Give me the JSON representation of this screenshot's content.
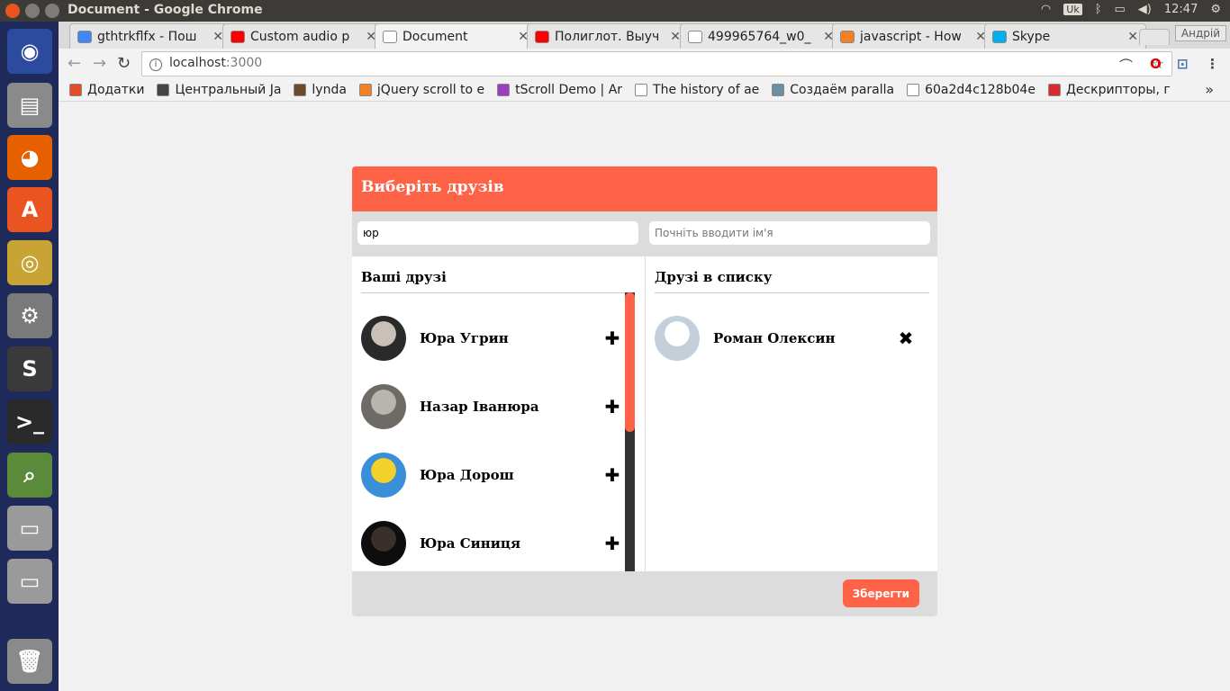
{
  "window": {
    "title": "Document - Google Chrome"
  },
  "tray": {
    "keyboard": "Uk",
    "time": "12:47"
  },
  "launcher": {
    "items": [
      {
        "name": "ubuntu-dash-icon",
        "color": "#2c4a9e"
      },
      {
        "name": "files-icon",
        "color": "#8a8a8a"
      },
      {
        "name": "firefox-icon",
        "color": "#e66000"
      },
      {
        "name": "software-center-icon",
        "color": "#e95420"
      },
      {
        "name": "chrome-icon",
        "color": "#c8a435"
      },
      {
        "name": "settings-icon",
        "color": "#7a7a7a"
      },
      {
        "name": "sublime-text-icon",
        "color": "#3a3a3a"
      },
      {
        "name": "terminal-icon",
        "color": "#2a2a2a"
      },
      {
        "name": "image-viewer-icon",
        "color": "#5a8a3a"
      },
      {
        "name": "drive-icon",
        "color": "#9a9a9a"
      },
      {
        "name": "drive-icon",
        "color": "#9a9a9a"
      },
      {
        "name": "trash-icon",
        "color": "#8a8a8a"
      }
    ]
  },
  "tabs": [
    {
      "label": "gthtrkflfx - Пош",
      "icon": "google-icon",
      "color": "#4285f4",
      "active": false
    },
    {
      "label": "Custom audio p",
      "icon": "youtube-icon",
      "color": "#ff0000",
      "active": false
    },
    {
      "label": "Document",
      "icon": "page-icon",
      "color": "#ffffff",
      "active": true
    },
    {
      "label": "Полиглот. Выуч",
      "icon": "youtube-icon",
      "color": "#ff0000",
      "active": false
    },
    {
      "label": "499965764_w0_",
      "icon": "page-icon",
      "color": "#ffffff",
      "active": false
    },
    {
      "label": "javascript - How",
      "icon": "stackoverflow-icon",
      "color": "#f48024",
      "active": false
    },
    {
      "label": "Skype",
      "icon": "skype-icon",
      "color": "#00aff0",
      "active": false
    }
  ],
  "profile": {
    "name": "Андрій"
  },
  "address": {
    "host": "localhost",
    "port": ":3000"
  },
  "bookmarks": {
    "items": [
      {
        "label": "Додатки",
        "icon": "apps-icon",
        "color": "#e14d2a"
      },
      {
        "label": "Центральный Ja",
        "icon": "bookmark-icon",
        "color": "#444444"
      },
      {
        "label": "lynda",
        "icon": "lynda-icon",
        "color": "#6b4a2e"
      },
      {
        "label": "jQuery scroll to e",
        "icon": "stackoverflow-icon",
        "color": "#f48024"
      },
      {
        "label": "tScroll Demo | Ar",
        "icon": "t-icon",
        "color": "#9b3fbf"
      },
      {
        "label": "The history of ae",
        "icon": "page-icon",
        "color": "#ffffff"
      },
      {
        "label": "Создаём paralla",
        "icon": "habr-icon",
        "color": "#6b8fa8"
      },
      {
        "label": "60a2d4c128b04e",
        "icon": "page-icon",
        "color": "#ffffff"
      },
      {
        "label": "Дескрипторы, г",
        "icon": "bookmark-icon",
        "color": "#d92b2b"
      }
    ],
    "more": "»"
  },
  "dialog": {
    "title": "Виберіть друзів",
    "search_left": {
      "value": "юр",
      "placeholder": ""
    },
    "search_right": {
      "value": "",
      "placeholder": "Почніть вводити ім'я"
    },
    "left_title": "Ваші друзі",
    "right_title": "Друзі в списку",
    "friends": [
      {
        "name": "Юра Угрин",
        "action": "✚",
        "avatar_colors": [
          "#2a2a2a",
          "#c9c1b8"
        ]
      },
      {
        "name": "Назар Іванюра",
        "action": "✚",
        "avatar_colors": [
          "#6e6a66",
          "#b8b4ae"
        ]
      },
      {
        "name": "Юра Дорош",
        "action": "✚",
        "avatar_colors": [
          "#3a8fd8",
          "#f2d12a"
        ]
      },
      {
        "name": "Юра Синиця",
        "action": "✚",
        "avatar_colors": [
          "#0d0d0d",
          "#3a2f2a"
        ]
      }
    ],
    "selected": [
      {
        "name": "Роман Олексин",
        "action": "✖",
        "avatar_colors": [
          "#c5cfd9",
          "#ffffff"
        ]
      }
    ],
    "save_label": "Зберегти"
  },
  "colors": {
    "accent": "#ff6347",
    "panel": "#dcdcdc"
  }
}
